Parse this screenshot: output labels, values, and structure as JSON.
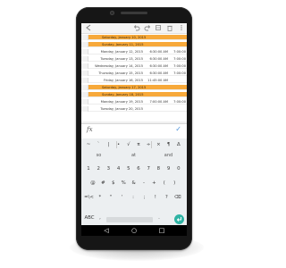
{
  "toolbar": {
    "icons": [
      "back-arrow-icon",
      "undo-icon",
      "redo-icon",
      "format-icon",
      "trash-icon",
      "more-options-icon"
    ]
  },
  "sheet": {
    "rows": [
      {
        "num": "",
        "a": "Saturday, January 10, 2015",
        "b": "",
        "c": "",
        "weekend": true
      },
      {
        "num": "",
        "a": "Sunday, January 11, 2015",
        "b": "",
        "c": "",
        "weekend": true
      },
      {
        "num": "",
        "a": "Monday, January 12, 2015",
        "b": "6:30:00 AM",
        "c": "7:00:00",
        "weekend": false
      },
      {
        "num": "",
        "a": "Tuesday, January 13, 2015",
        "b": "6:30:00 AM",
        "c": "7:00:00",
        "weekend": false
      },
      {
        "num": "",
        "a": "Wednesday, January 14, 2015",
        "b": "6:30:00 AM",
        "c": "7:00:00",
        "weekend": false
      },
      {
        "num": "",
        "a": "Thursday, January 15, 2015",
        "b": "6:30:00 AM",
        "c": "7:00:00",
        "weekend": false
      },
      {
        "num": "",
        "a": "Friday, January 16, 2015",
        "b": "11:45:00 AM",
        "c": "",
        "weekend": false
      },
      {
        "num": "",
        "a": "Saturday, January 17, 2015",
        "b": "",
        "c": "",
        "weekend": true
      },
      {
        "num": "",
        "a": "Sunday, January 18, 2015",
        "b": "",
        "c": "",
        "weekend": true
      },
      {
        "num": "",
        "a": "Monday, January 19, 2015",
        "b": "7:00:00 AM",
        "c": "7:00:00",
        "weekend": false
      },
      {
        "num": "",
        "a": "Tuesday, January 20, 2015",
        "b": "",
        "c": "",
        "weekend": false
      }
    ]
  },
  "formula_bar": {
    "fx_label": "fx",
    "confirm_label": "✓",
    "value": ""
  },
  "keyboard": {
    "symbols_row": [
      "~",
      "`",
      "|",
      "•",
      "√",
      "π",
      "÷",
      "×",
      "¶",
      "Δ"
    ],
    "suggestions": [
      "so",
      "at",
      "and"
    ],
    "digits": [
      "1",
      "2",
      "3",
      "4",
      "5",
      "6",
      "7",
      "8",
      "9",
      "0"
    ],
    "row3": [
      "@",
      "#",
      "$",
      "%",
      "&",
      "-",
      "+",
      "(",
      ")"
    ],
    "row4": [
      "=\\<",
      "*",
      "\"",
      "'",
      ":",
      ";",
      "!",
      "?",
      "⌫"
    ],
    "bottom_left": "ABC",
    "bottom_comma": ",",
    "bottom_period": "."
  },
  "navbar": {
    "back": "◁",
    "home": "○",
    "recents": "□"
  },
  "colors": {
    "weekend_fill": "#f7a93a",
    "enter_key": "#2fb3a4"
  }
}
